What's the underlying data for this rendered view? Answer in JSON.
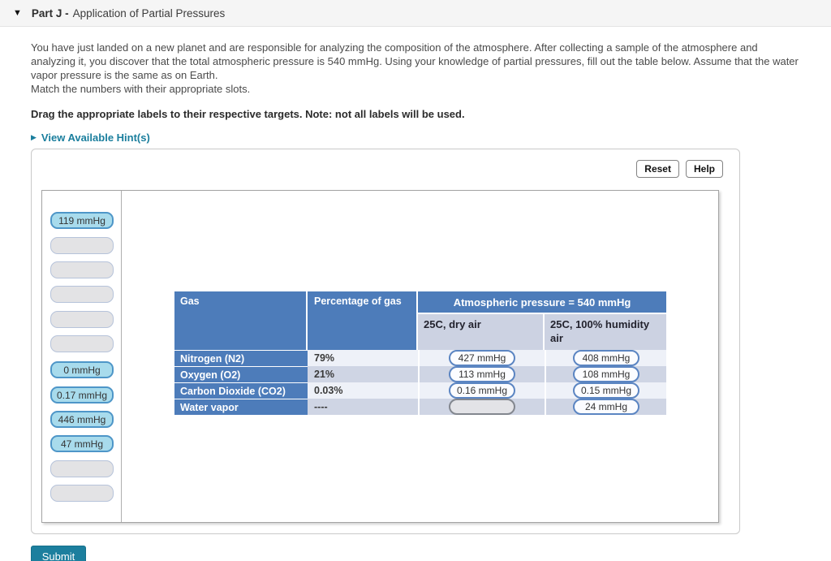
{
  "header": {
    "collapse_icon": "▼",
    "part_label": "Part J -",
    "part_title": "Application of Partial Pressures"
  },
  "intro": {
    "paragraph": "You have just landed on a new planet and are responsible for analyzing the composition of the atmosphere. After collecting a sample of the atmosphere and analyzing it, you discover that the total atmospheric pressure is 540 mmHg. Using your knowledge of partial pressures, fill out the table below. Assume that the water vapor pressure is the same as on Earth.",
    "match_line": "Match the numbers with their appropriate slots.",
    "drag_instruction": "Drag the appropriate labels to their respective targets. Note: not all labels will be used.",
    "hint_icon": "▶",
    "hint_link": "View Available Hint(s)"
  },
  "activity": {
    "reset_label": "Reset",
    "help_label": "Help",
    "bin_labels": [
      {
        "text": "119 mmHg",
        "state": "available"
      },
      {
        "text": "",
        "state": "used"
      },
      {
        "text": "",
        "state": "used"
      },
      {
        "text": "",
        "state": "used"
      },
      {
        "text": "",
        "state": "used"
      },
      {
        "text": "",
        "state": "used"
      },
      {
        "text": "0 mmHg",
        "state": "available"
      },
      {
        "text": "0.17 mmHg",
        "state": "available"
      },
      {
        "text": "446 mmHg",
        "state": "available"
      },
      {
        "text": "47 mmHg",
        "state": "available"
      },
      {
        "text": "",
        "state": "used"
      },
      {
        "text": "",
        "state": "used"
      }
    ],
    "table": {
      "col_gas_header": "Gas",
      "col_pct_header": "Percentage of gas",
      "pressure_header": "Atmospheric pressure = 540 mmHg",
      "sub_dry": "25C, dry air",
      "sub_humid": "25C, 100% humidity air",
      "rows": [
        {
          "gas": "Nitrogen (N2)",
          "pct": "79%",
          "dry": "427 mmHg",
          "humid": "408 mmHg"
        },
        {
          "gas": "Oxygen (O2)",
          "pct": "21%",
          "dry": "113 mmHg",
          "humid": "108 mmHg"
        },
        {
          "gas": "Carbon Dioxide (CO2)",
          "pct": "0.03%",
          "dry": "0.16 mmHg",
          "humid": "0.15 mmHg"
        },
        {
          "gas": "Water vapor",
          "pct": "----",
          "dry": "",
          "humid": "24 mmHg"
        }
      ]
    }
  },
  "submit_label": "Submit",
  "colors": {
    "accent_teal": "#1c7f9e",
    "table_blue": "#4d7cba",
    "subheader_blue_gray": "#ccd2e2",
    "chip_active_fill": "#a8dbec",
    "chip_active_border": "#4e96c8",
    "chip_dropped_border": "#5b85c2",
    "row_light": "#eef1f8",
    "row_dark": "#cfd5e4"
  }
}
